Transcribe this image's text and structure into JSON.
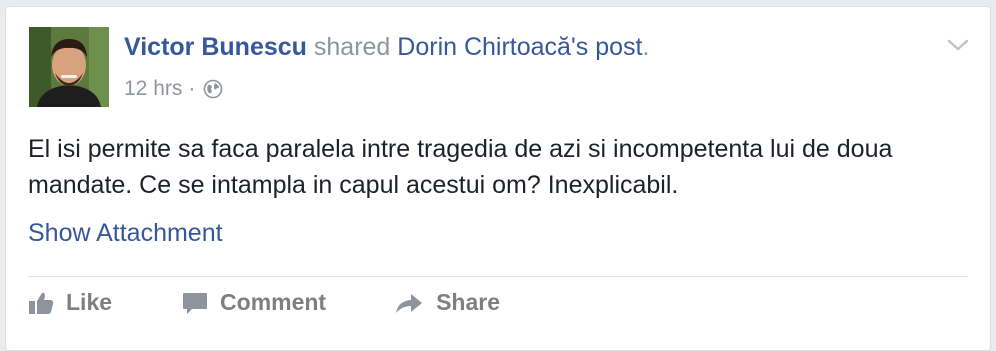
{
  "post": {
    "author": "Victor Bunescu",
    "shared_text": " shared ",
    "original_author": "Dorin Chirtoacă",
    "original_suffix": "'s post",
    "period": ".",
    "time": "12 hrs",
    "separator": "·",
    "privacy_icon": "globe-icon",
    "options_icon": "chevron-down-icon",
    "body": "El isi permite sa faca paralela intre tragedia de azi si incompetenta lui de doua mandate. Ce se intampla in capul acestui om? Inexplicabil.",
    "attachment_link": "Show Attachment"
  },
  "actions": {
    "like_label": "Like",
    "comment_label": "Comment",
    "share_label": "Share"
  },
  "colors": {
    "link": "#365899",
    "meta": "#90949c",
    "text": "#1d2129",
    "action": "#7f7f7f"
  }
}
